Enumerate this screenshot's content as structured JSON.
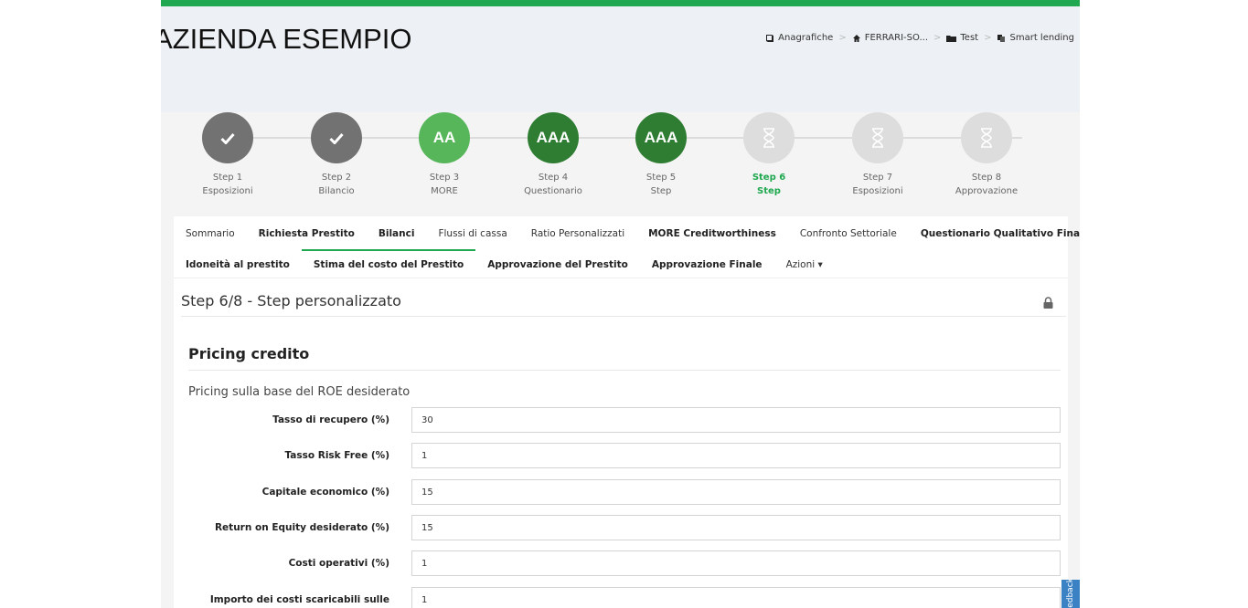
{
  "header": {
    "company": "AZIENDA ESEMPIO",
    "breadcrumbs": [
      {
        "icon": "book-icon",
        "label": "Anagrafiche"
      },
      {
        "icon": "home-icon",
        "label": "FERRARI-SO..."
      },
      {
        "icon": "folder-icon",
        "label": "Test"
      },
      {
        "icon": "copy-icon",
        "label": "Smart lending"
      }
    ],
    "separator": ">"
  },
  "colors": {
    "accent": "#1fa84f",
    "done": "#727272",
    "rating_light": "#57b65a",
    "rating_dark": "#2e7d32",
    "pending": "#dddddd"
  },
  "steps": [
    {
      "badge": "",
      "icon": "check-icon",
      "line1": "Step 1",
      "line2": "Esposizioni",
      "state": "done"
    },
    {
      "badge": "",
      "icon": "check-icon",
      "line1": "Step 2",
      "line2": "Bilancio",
      "state": "done"
    },
    {
      "badge": "AA",
      "icon": "",
      "line1": "Step 3",
      "line2": "MORE",
      "state": "rated-light"
    },
    {
      "badge": "AAA",
      "icon": "",
      "line1": "Step 4",
      "line2": "Questionario",
      "state": "rated-dark"
    },
    {
      "badge": "AAA",
      "icon": "",
      "line1": "Step 5",
      "line2": "Step",
      "state": "rated-dark"
    },
    {
      "badge": "",
      "icon": "hourglass-icon",
      "line1": "Step 6",
      "line2": "Step",
      "state": "active"
    },
    {
      "badge": "",
      "icon": "hourglass-icon",
      "line1": "Step 7",
      "line2": "Esposizioni",
      "state": "pending"
    },
    {
      "badge": "",
      "icon": "hourglass-icon",
      "line1": "Step 8",
      "line2": "Approvazione",
      "state": "pending"
    }
  ],
  "tabs_row1": [
    {
      "label": "Sommario",
      "bold": false
    },
    {
      "label": "Richiesta Prestito",
      "bold": true
    },
    {
      "label": "Bilanci",
      "bold": true
    },
    {
      "label": "Flussi di cassa",
      "bold": false
    },
    {
      "label": "Ratio Personalizzati",
      "bold": false
    },
    {
      "label": "MORE Creditworthiness",
      "bold": true
    },
    {
      "label": "Confronto Settoriale",
      "bold": false
    },
    {
      "label": "Questionario Qualitativo Finanziario",
      "bold": true
    }
  ],
  "tabs_row2": [
    {
      "label": "Idoneità al prestito",
      "bold": true
    },
    {
      "label": "Stima del costo del Prestito",
      "bold": true,
      "active": true
    },
    {
      "label": "Approvazione del Prestito",
      "bold": true
    },
    {
      "label": "Approvazione Finale",
      "bold": true
    },
    {
      "label": "Azioni ▾",
      "bold": false
    }
  ],
  "panel": {
    "step_title": "Step 6/8 - Step personalizzato",
    "section_title": "Pricing credito",
    "subtitle": "Pricing sulla base del ROE desiderato"
  },
  "fields": [
    {
      "label": "Tasso di recupero (%)",
      "value": "30"
    },
    {
      "label": "Tasso Risk Free (%)",
      "value": "1"
    },
    {
      "label": "Capitale economico (%)",
      "value": "15"
    },
    {
      "label": "Return on Equity desiderato (%)",
      "value": "15"
    },
    {
      "label": "Costi operativi (%)",
      "value": "1"
    },
    {
      "label": "Importo dei costi scaricabili sulle",
      "value": "1"
    }
  ],
  "feedback_label": "Feedback"
}
